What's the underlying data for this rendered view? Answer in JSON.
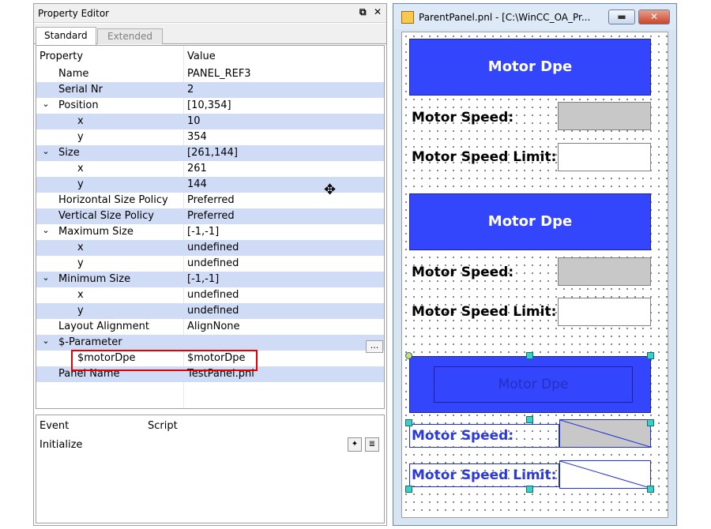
{
  "property_editor": {
    "title": "Property Editor",
    "tabs": [
      "Standard",
      "Extended"
    ],
    "columns": {
      "property": "Property",
      "value": "Value"
    },
    "rows": [
      {
        "key": "Name",
        "value": "PANEL_REF3",
        "level": 1,
        "expander": ""
      },
      {
        "key": "Serial Nr",
        "value": "2",
        "level": 1,
        "expander": ""
      },
      {
        "key": "Position",
        "value": "[10,354]",
        "level": 1,
        "expander": "⌄"
      },
      {
        "key": "x",
        "value": "10",
        "level": 2,
        "expander": ""
      },
      {
        "key": "y",
        "value": "354",
        "level": 2,
        "expander": ""
      },
      {
        "key": "Size",
        "value": "[261,144]",
        "level": 1,
        "expander": "⌄"
      },
      {
        "key": "x",
        "value": "261",
        "level": 2,
        "expander": ""
      },
      {
        "key": "y",
        "value": "144",
        "level": 2,
        "expander": ""
      },
      {
        "key": "Horizontal Size Policy",
        "value": "Preferred",
        "level": 1,
        "expander": ""
      },
      {
        "key": "Vertical Size Policy",
        "value": "Preferred",
        "level": 1,
        "expander": ""
      },
      {
        "key": "Maximum Size",
        "value": "[-1,-1]",
        "level": 1,
        "expander": "⌄"
      },
      {
        "key": "x",
        "value": "undefined",
        "level": 2,
        "expander": ""
      },
      {
        "key": "y",
        "value": "undefined",
        "level": 2,
        "expander": ""
      },
      {
        "key": "Minimum Size",
        "value": "[-1,-1]",
        "level": 1,
        "expander": "⌄"
      },
      {
        "key": "x",
        "value": "undefined",
        "level": 2,
        "expander": ""
      },
      {
        "key": "y",
        "value": "undefined",
        "level": 2,
        "expander": ""
      },
      {
        "key": "Layout Alignment",
        "value": "AlignNone",
        "level": 1,
        "expander": ""
      },
      {
        "key": "$-Parameter",
        "value": "",
        "level": 1,
        "expander": "⌄"
      },
      {
        "key": "$motorDpe",
        "value": "$motorDpe",
        "level": 2,
        "expander": ""
      },
      {
        "key": "Panel Name",
        "value": "TestPanel.pnl",
        "level": 1,
        "expander": ""
      }
    ],
    "dots_button": "...",
    "events": {
      "event_col": "Event",
      "script_col": "Script",
      "items": [
        "Initialize"
      ]
    }
  },
  "parent_panel": {
    "title": "ParentPanel.pnl - [C:\\WinCC_OA_Pr...",
    "groups": [
      {
        "button": "Motor Dpe",
        "speed_label": "Motor Speed:",
        "limit_label": "Motor Speed Limit:"
      },
      {
        "button": "Motor Dpe",
        "speed_label": "Motor Speed:",
        "limit_label": "Motor Speed Limit:"
      },
      {
        "button": "Motor Dpe",
        "speed_label": "Motor Speed:",
        "limit_label": "Motor Speed Limit:"
      }
    ]
  }
}
